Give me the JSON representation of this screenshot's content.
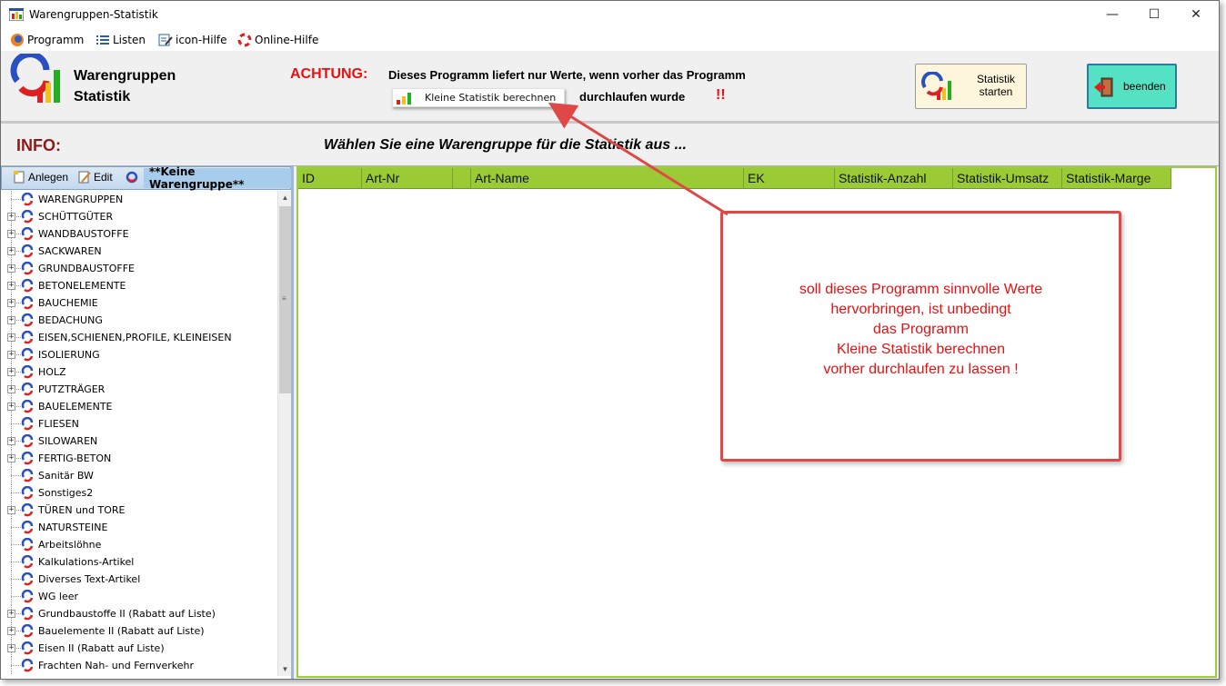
{
  "window": {
    "title": "Warengruppen-Statistik",
    "minimize_glyph": "—",
    "maximize_glyph": "☐",
    "close_glyph": "✕"
  },
  "menu": [
    {
      "label": "Programm",
      "icon": "firefox-like-icon"
    },
    {
      "label": "Listen",
      "icon": "list-icon"
    },
    {
      "label": "icon-Hilfe",
      "icon": "edit-help-icon"
    },
    {
      "label": "Online-Hilfe",
      "icon": "lifebuoy-icon"
    }
  ],
  "header": {
    "logo_title_line1": "Warengruppen",
    "logo_title_line2": "Statistik",
    "achtung_label": "ACHTUNG:",
    "achtung_text1": "Dieses Programm liefert nur Werte, wenn vorher das  Programm",
    "kleine_button_label": "Kleine Statistik berechnen",
    "achtung_text2": "durchlaufen wurde",
    "exclamation": "!!",
    "start_button_label": "Statistik\nstarten",
    "exit_button_label": "beenden"
  },
  "info": {
    "label": "INFO:",
    "text": "Wählen Sie eine Warengruppe für die Statistik aus ..."
  },
  "tree_toolbar": {
    "add_label": "Anlegen",
    "edit_label": "Edit",
    "current_group": "**Keine Warengruppe**"
  },
  "tree_items": [
    {
      "label": "WARENGRUPPEN",
      "expandable": false
    },
    {
      "label": "SCHÜTTGÜTER",
      "expandable": true
    },
    {
      "label": "WANDBAUSTOFFE",
      "expandable": true
    },
    {
      "label": "SACKWAREN",
      "expandable": true
    },
    {
      "label": "GRUNDBAUSTOFFE",
      "expandable": true
    },
    {
      "label": "BETONELEMENTE",
      "expandable": true
    },
    {
      "label": "BAUCHEMIE",
      "expandable": true
    },
    {
      "label": "BEDACHUNG",
      "expandable": true
    },
    {
      "label": "EISEN,SCHIENEN,PROFILE, KLEINEISEN",
      "expandable": true
    },
    {
      "label": "ISOLIERUNG",
      "expandable": true
    },
    {
      "label": "HOLZ",
      "expandable": true
    },
    {
      "label": "PUTZTRÄGER",
      "expandable": true
    },
    {
      "label": "BAUELEMENTE",
      "expandable": true
    },
    {
      "label": "FLIESEN",
      "expandable": false
    },
    {
      "label": "SILOWAREN",
      "expandable": true
    },
    {
      "label": "FERTIG-BETON",
      "expandable": true
    },
    {
      "label": "Sanitär BW",
      "expandable": false
    },
    {
      "label": "Sonstiges2",
      "expandable": false
    },
    {
      "label": "TÜREN und TORE",
      "expandable": true
    },
    {
      "label": "NATURSTEINE",
      "expandable": false
    },
    {
      "label": "Arbeitslöhne",
      "expandable": false
    },
    {
      "label": "Kalkulations-Artikel",
      "expandable": false
    },
    {
      "label": "Diverses Text-Artikel",
      "expandable": false
    },
    {
      "label": "WG leer",
      "expandable": false
    },
    {
      "label": "Grundbaustoffe II (Rabatt auf Liste)",
      "expandable": true
    },
    {
      "label": "Bauelemente II (Rabatt auf Liste)",
      "expandable": true
    },
    {
      "label": "Eisen II (Rabatt auf Liste)",
      "expandable": true
    },
    {
      "label": "Frachten Nah- und Fernverkehr",
      "expandable": false
    }
  ],
  "grid": {
    "columns": [
      "ID",
      "Art-Nr",
      "",
      "Art-Name",
      "EK",
      "Statistik-Anzahl",
      "Statistik-Umsatz",
      "Statistik-Marge"
    ]
  },
  "annotation": {
    "text": "soll dieses Programm sinnvolle Werte\nhervorbringen, ist unbedingt\ndas Programm\nKleine Statistik berechnen\nvorher durchlaufen zu lassen !",
    "color": "#e81010"
  },
  "colors": {
    "accent_red": "#e81010",
    "grid_header": "#9acb34",
    "exit_button": "#55e2c4",
    "start_button": "#fdf6dc",
    "info_label": "#8b1a1a"
  }
}
